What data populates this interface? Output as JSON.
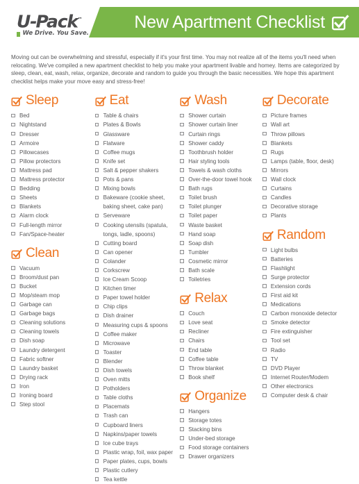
{
  "header": {
    "logo_word": "U-Pack",
    "logo_tagline": "We Drive. You Save.",
    "banner_title": "New Apartment Checklist",
    "banner_check_icon": "checked-checkbox-icon",
    "banner_color": "#7ab648",
    "accent_color": "#ee7623"
  },
  "intro": {
    "text": "Moving out can be overwhelming and stressful, especially if it's your first time. You may not realize all of the items you'll need when relocating. We've compiled a new apartment checklist to help you make your apartment livable and homey. Items are categorized by sleep, clean, eat, wash, relax, organize, decorate and random to guide you through the basic necessities. We hope this apartment checklist helps make your move easy and stress-free!"
  },
  "columns": [
    {
      "sections": [
        {
          "title": "Sleep",
          "icon": "checked-checkbox-icon",
          "items": [
            "Bed",
            "Nightstand",
            "Dresser",
            "Armoire",
            "Pillowcases",
            "Pillow protectors",
            "Mattress pad",
            "Mattress protector",
            "Bedding",
            "Sheets",
            "Blankets",
            "Alarm clock",
            "Full-length mirror",
            "Fan/Space-heater"
          ]
        },
        {
          "title": "Clean",
          "icon": "checked-checkbox-icon",
          "items": [
            "Vacuum",
            "Broom/dust pan",
            "Bucket",
            "Mop/steam mop",
            "Garbage can",
            "Garbage bags",
            "Cleaning solutions",
            "Cleaning towels",
            "Dish soap",
            "Laundry detergent",
            "Fabric softner",
            "Laundry basket",
            "Drying rack",
            "Iron",
            "Ironing board",
            "Step stool"
          ]
        }
      ]
    },
    {
      "sections": [
        {
          "title": "Eat",
          "icon": "checked-checkbox-icon",
          "items": [
            "Table & chairs",
            "Plates & Bowls",
            "Glassware",
            "Flatware",
            "Coffee mugs",
            "Knife set",
            "Salt & pepper shakers",
            "Pots & pans",
            "Mixing bowls",
            "Bakeware (cookie sheet, baking sheet, cake pan)",
            "Serveware",
            "Cooking utensils (spatula, tongs, ladle, spoons)",
            "Cutting board",
            "Can opener",
            "Colander",
            "Corkscrew",
            "Ice Cream Scoop",
            "Kitchen timer",
            "Paper towel holder",
            "Chip clips",
            "Dish drainer",
            "Measuring cups & spoons",
            "Coffee maker",
            "Microwave",
            "Toaster",
            "Blender",
            "Dish towels",
            "Oven mitts",
            "Potholders",
            "Table cloths",
            "Placemats",
            "Trash can",
            "Cupboard liners",
            "Napkins/paper towels",
            "Ice cube trays",
            "Plastic wrap, foil, wax paper",
            "Paper plates, cups, bowls",
            "Plastic cutlery",
            "Tea kettle"
          ]
        }
      ]
    },
    {
      "sections": [
        {
          "title": "Wash",
          "icon": "checked-checkbox-icon",
          "items": [
            "Shower curtain",
            "Shower curtain liner",
            "Curtain rings",
            "Shower caddy",
            "Toothbrush holder",
            "Hair styling tools",
            "Towels & wash cloths",
            "Over-the-door towel hook",
            "Bath rugs",
            "Toilet brush",
            "Toilet plunger",
            "Toilet paper",
            "Waste basket",
            "Hand soap",
            "Soap dish",
            "Tumbler",
            "Cosmetic mirror",
            "Bath scale",
            "Toiletries"
          ]
        },
        {
          "title": "Relax",
          "icon": "checked-checkbox-icon",
          "items": [
            "Couch",
            "Love seat",
            "Recliner",
            "Chairs",
            "End table",
            "Coffee table",
            "Throw blanket",
            "Book shelf"
          ]
        },
        {
          "title": "Organize",
          "icon": "checked-checkbox-icon",
          "items": [
            "Hangers",
            "Storage totes",
            "Stacking bins",
            "Under-bed storage",
            "Food storage containers",
            "Drawer organizers"
          ]
        }
      ]
    },
    {
      "sections": [
        {
          "title": "Decorate",
          "icon": "checked-checkbox-icon",
          "items": [
            "Picture frames",
            "Wall art",
            "Throw pillows",
            "Blankets",
            "Rugs",
            "Lamps (table, floor, desk)",
            "Mirrors",
            "Wall clock",
            "Curtains",
            "Candles",
            "Decorative storage",
            "Plants"
          ]
        },
        {
          "title": "Random",
          "icon": "checked-checkbox-icon",
          "items": [
            "Light bulbs",
            "Batteries",
            "Flashlight",
            "Surge protector",
            "Extension cords",
            "First aid kit",
            "Medications",
            "Carbon monoxide detector",
            "Smoke detector",
            "Fire extinguisher",
            "Tool set",
            "Radio",
            "TV",
            "DVD Player",
            "Internet Router/Modem",
            "Other electronics",
            "Computer desk & chair"
          ]
        }
      ]
    }
  ]
}
